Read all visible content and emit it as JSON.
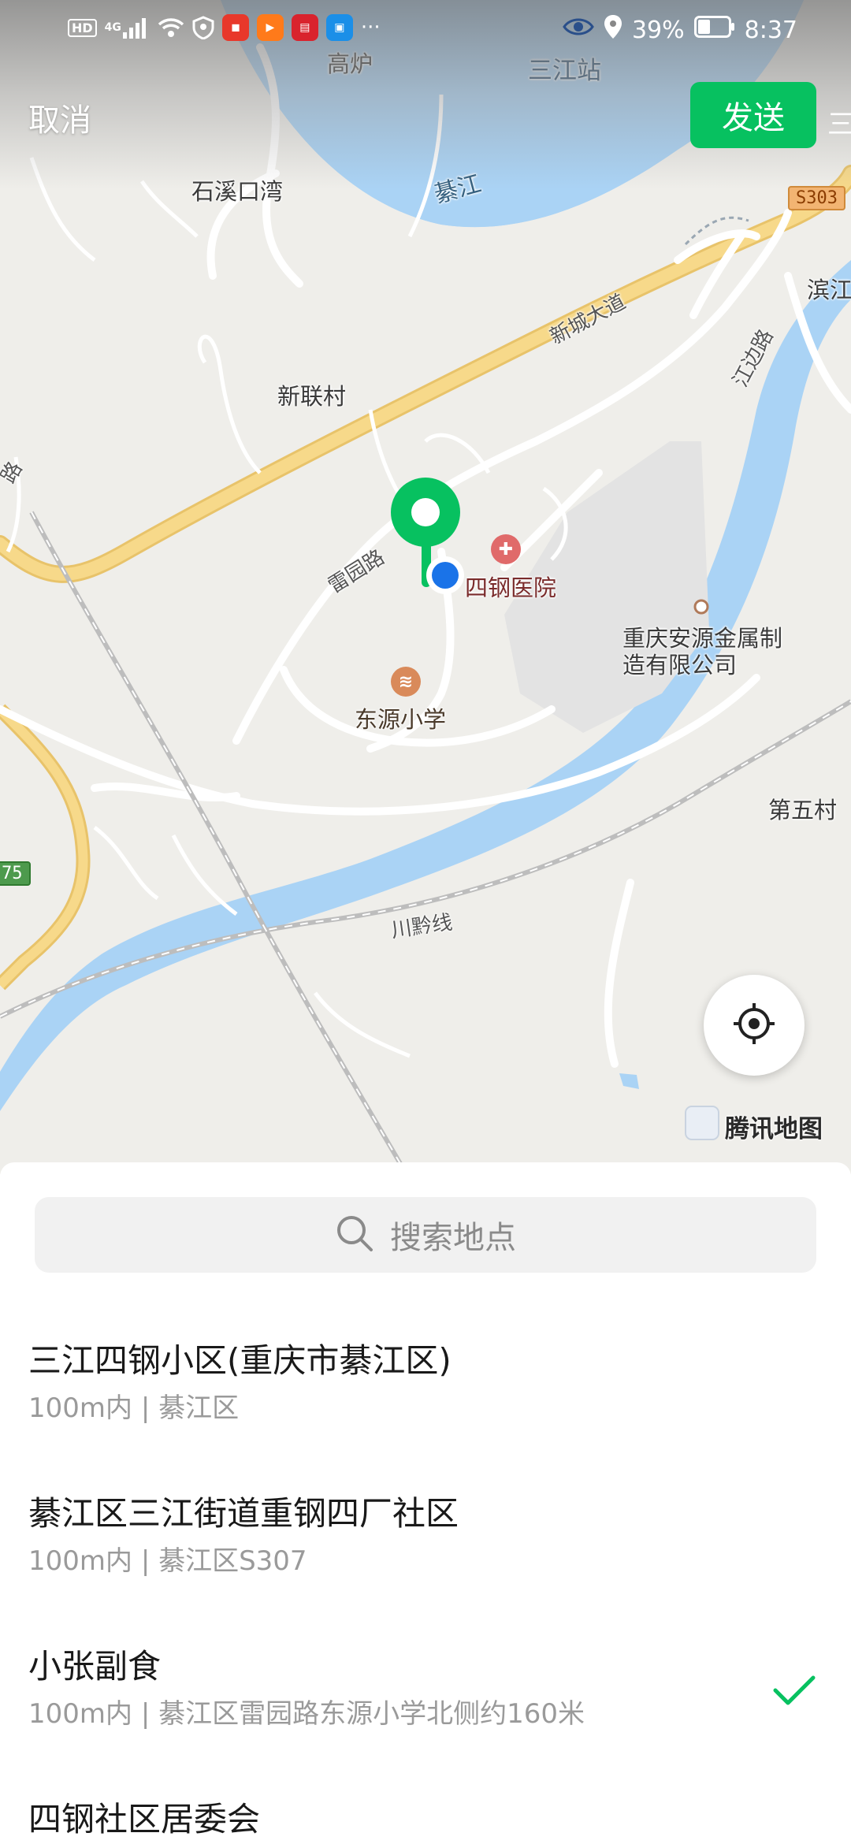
{
  "status_bar": {
    "left_icons": [
      "hd-icon",
      "signal-4g-icon",
      "wifi-icon",
      "shield-icon",
      "app-icon-1",
      "app-icon-2",
      "app-icon-3",
      "app-icon-4",
      "more-dots"
    ],
    "hd": "HD",
    "net": "4G",
    "dots": "···",
    "battery": "39%",
    "time": "8:37"
  },
  "header": {
    "cancel_label": "取消",
    "send_label": "发送"
  },
  "map": {
    "labels": {
      "gaolu": "高炉",
      "sanjiang_station": "三江站",
      "shixikouwan": "石溪口湾",
      "qijiang": "綦江",
      "s303": "S303",
      "binjiang": "滨江",
      "xinchengdadao": "新城大道",
      "jiangbianlu": "江边路",
      "xinliancun": "新联村",
      "leiyuanlu": "雷园路",
      "hospital": "四钢医院",
      "company": "重庆安源金属制造有限公司",
      "school": "东源小学",
      "diwucun": "第五村",
      "chuanqianxian": "川黔线",
      "shield75": "75",
      "edge_left": "路",
      "edge_top_right": "三"
    },
    "brand": "腾讯地图",
    "colors": {
      "river": "#aad3f5",
      "major_road": "#f7d27a",
      "pin": "#07c160",
      "current_location": "#1a73e8"
    }
  },
  "search": {
    "placeholder": "搜索地点"
  },
  "places": [
    {
      "name": "三江四钢小区(重庆市綦江区)",
      "detail": "100m内 | 綦江区",
      "selected": false
    },
    {
      "name": "綦江区三江街道重钢四厂社区",
      "detail": "100m内 | 綦江区S307",
      "selected": false
    },
    {
      "name": "小张副食",
      "detail": "100m内 | 綦江区雷园路东源小学北侧约160米",
      "selected": true
    },
    {
      "name": "四钢社区居委会",
      "detail": "",
      "selected": false
    }
  ]
}
